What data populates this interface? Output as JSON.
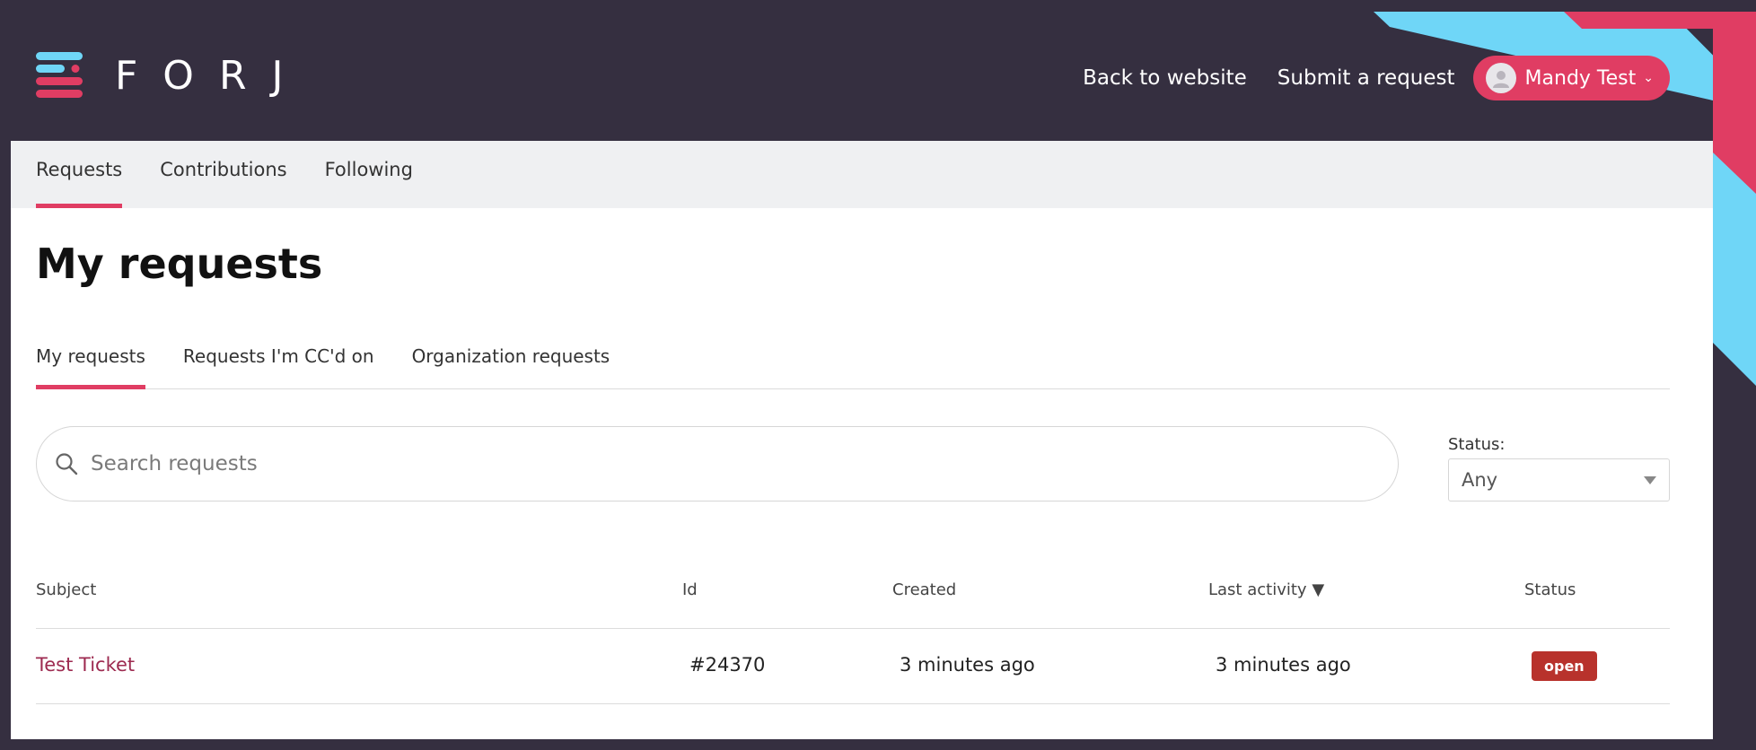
{
  "brand": {
    "name": "FORJ"
  },
  "header": {
    "links": [
      "Back to website",
      "Submit a request"
    ],
    "user_name": "Mandy Test"
  },
  "subnav": {
    "tabs": [
      "Requests",
      "Contributions",
      "Following"
    ]
  },
  "page_title": "My requests",
  "tabs": [
    "My requests",
    "Requests I'm CC'd on",
    "Organization requests"
  ],
  "search": {
    "placeholder": "Search requests"
  },
  "status_filter": {
    "label": "Status:",
    "value": "Any"
  },
  "table": {
    "columns": [
      "Subject",
      "Id",
      "Created",
      "Last activity",
      "Status"
    ],
    "sort_indicator": "▼",
    "rows": [
      {
        "subject": "Test Ticket",
        "id": "#24370",
        "created": "3 minutes ago",
        "last_activity": "3 minutes ago",
        "status": "open"
      }
    ]
  },
  "colors": {
    "background": "#352f40",
    "accent": "#e03d63",
    "cyan": "#6fd6f7",
    "status_open": "#b8322c"
  }
}
